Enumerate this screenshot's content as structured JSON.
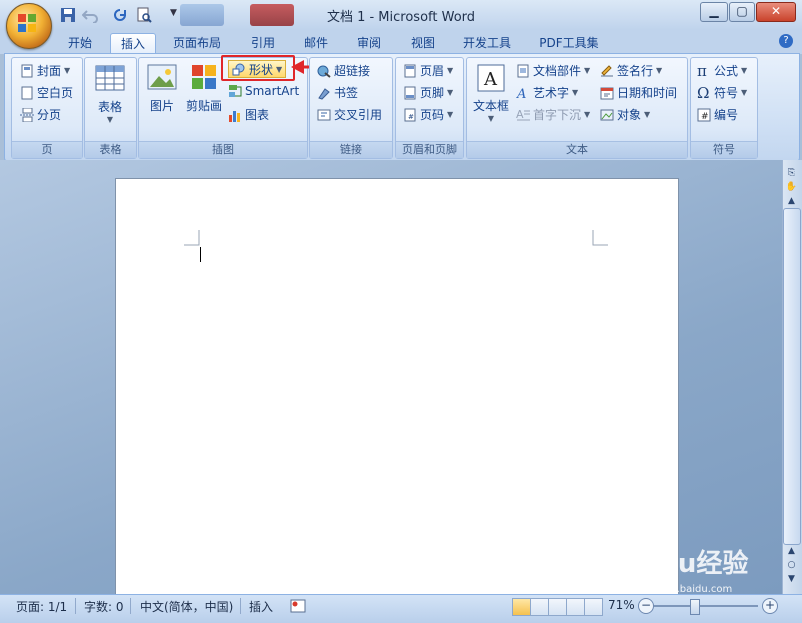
{
  "window": {
    "title": "文档 1 - Microsoft Word"
  },
  "ribbon_tabs": [
    "开始",
    "插入",
    "页面布局",
    "引用",
    "邮件",
    "审阅",
    "视图",
    "开发工具",
    "PDF工具集"
  ],
  "active_tab": "插入",
  "groups": {
    "page": {
      "label": "页",
      "items": [
        "封面",
        "空白页",
        "分页"
      ]
    },
    "table": {
      "label": "表格",
      "items": [
        "表格"
      ]
    },
    "illustrations": {
      "label": "插图",
      "items": [
        "图片",
        "剪贴画",
        "形状",
        "SmartArt",
        "图表"
      ]
    },
    "links": {
      "label": "链接",
      "items": [
        "超链接",
        "书签",
        "交叉引用"
      ]
    },
    "header_footer": {
      "label": "页眉和页脚",
      "items": [
        "页眉",
        "页脚",
        "页码"
      ]
    },
    "text": {
      "label": "文本",
      "items": [
        "文本框",
        "文档部件",
        "艺术字",
        "首字下沉",
        "签名行",
        "日期和时间",
        "对象"
      ]
    },
    "symbols": {
      "label": "符号",
      "items": [
        "公式",
        "符号",
        "编号"
      ]
    }
  },
  "status_bar": {
    "page": "页面: 1/1",
    "words": "字数: 0",
    "language": "中文(简体，中国)",
    "mode": "插入",
    "zoom": "71%"
  },
  "watermark": {
    "main": "Baidu经验",
    "sub": "jingyan.baidu.com"
  },
  "colors": {
    "highlight": "#e0262a",
    "ribbon_text": "#15428b"
  }
}
